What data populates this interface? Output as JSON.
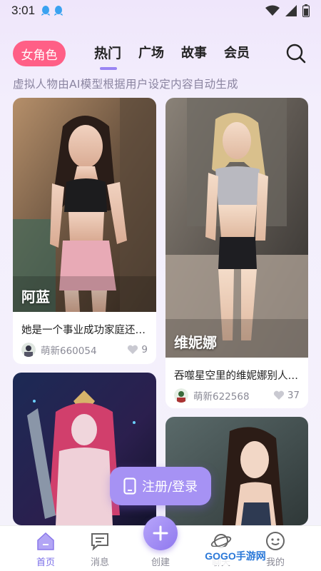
{
  "status": {
    "time": "3:01"
  },
  "header": {
    "category_pill": "女角色",
    "tabs": [
      {
        "label": "热门",
        "active": true
      },
      {
        "label": "广场",
        "active": false
      },
      {
        "label": "故事",
        "active": false
      },
      {
        "label": "会员",
        "active": false
      }
    ]
  },
  "subtitle": "虚拟人物由AI模型根据用户设定内容自动生成",
  "cards": [
    {
      "name": "阿蓝",
      "desc": "她是一个事业成功家庭还…",
      "user": "萌新660054",
      "likes": "9"
    },
    {
      "name": "维妮娜",
      "desc": "吞噬星空里的维妮娜别人…",
      "user": "萌新622568",
      "likes": "37"
    },
    {
      "name": "",
      "desc": "",
      "user": "",
      "likes": ""
    },
    {
      "name": "",
      "desc": "",
      "user": "",
      "likes": ""
    }
  ],
  "login_button": "注册/登录",
  "bottom_nav": {
    "items": [
      {
        "label": "首页",
        "icon": "home-icon",
        "active": true
      },
      {
        "label": "消息",
        "icon": "message-icon",
        "active": false
      },
      {
        "label": "创建",
        "icon": "plus-icon",
        "active": false
      },
      {
        "label": "聊天",
        "icon": "chat-planet-icon",
        "active": false
      },
      {
        "label": "我的",
        "icon": "smile-profile-icon",
        "active": false
      }
    ]
  },
  "watermark": "GOGO手游网",
  "colors": {
    "accent_pink": "#ff5f86",
    "accent_purple": "#9a84f3",
    "text_gray": "#8a8a96"
  }
}
